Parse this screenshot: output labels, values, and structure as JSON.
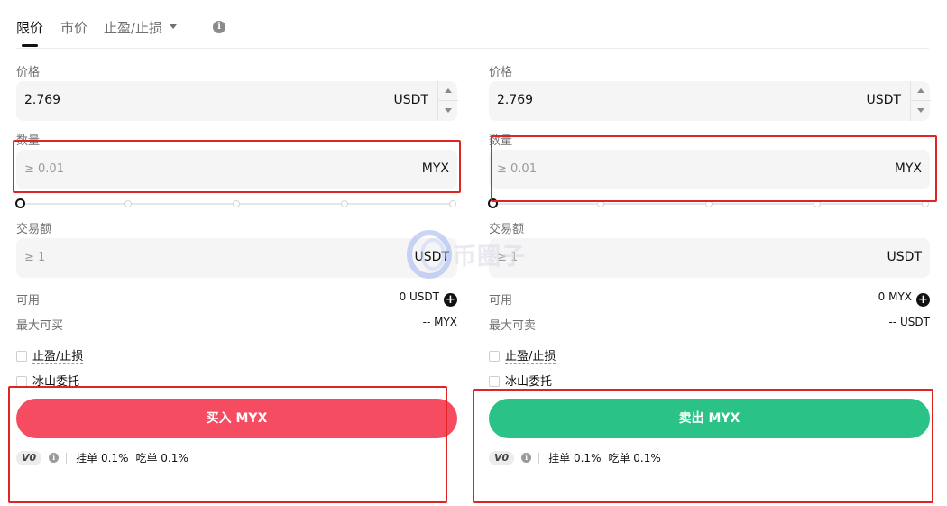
{
  "tabs": [
    {
      "label": "限价",
      "active": true
    },
    {
      "label": "市价",
      "active": false
    },
    {
      "label": "止盈/止损",
      "active": false
    }
  ],
  "buy": {
    "price_label": "价格",
    "price_value": "2.769",
    "price_unit": "USDT",
    "qty_label": "数量",
    "qty_placeholder": "≥ 0.01",
    "qty_unit": "MYX",
    "amount_label": "交易额",
    "amount_placeholder": "≥ 1",
    "amount_unit": "USDT",
    "available_label": "可用",
    "available_value": "0 USDT",
    "max_label": "最大可买",
    "max_value": "-- MYX",
    "tpsl_label": "止盈/止损",
    "iceberg_label": "冰山委托",
    "button_label": "买入 MYX",
    "slider_value_percent": 0
  },
  "sell": {
    "price_label": "价格",
    "price_value": "2.769",
    "price_unit": "USDT",
    "qty_label": "数量",
    "qty_placeholder": "≥ 0.01",
    "qty_unit": "MYX",
    "amount_label": "交易额",
    "amount_placeholder": "≥ 1",
    "amount_unit": "USDT",
    "available_label": "可用",
    "available_value": "0 MYX",
    "max_label": "最大可卖",
    "max_value": "-- USDT",
    "tpsl_label": "止盈/止损",
    "iceberg_label": "冰山委托",
    "button_label": "卖出 MYX",
    "slider_value_percent": 0
  },
  "fees": {
    "vip_level": "V0",
    "maker": "挂单 0.1%",
    "taker": "吃单 0.1%"
  },
  "watermark": "币圈子",
  "colors": {
    "buy": "#f54c62",
    "sell": "#2bc287",
    "annotation": "#e02424"
  }
}
